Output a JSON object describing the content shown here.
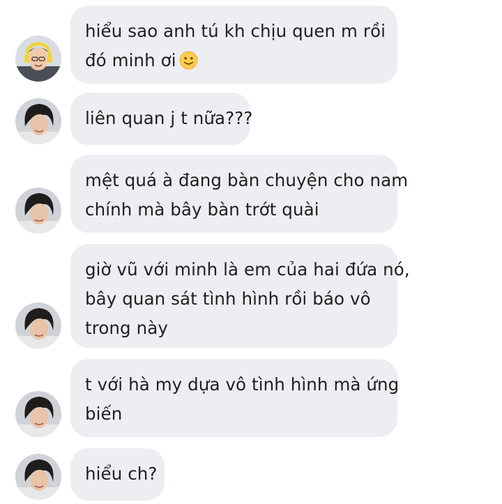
{
  "chat": {
    "messages": [
      {
        "lines": [
          "hiểu sao anh tú kh chịu quen m rồi",
          "đó minh ơi"
        ],
        "emoji": "slightly-smiling-face-icon",
        "avatar": "avatar-boy-yellow-headphones"
      },
      {
        "lines": [
          "liên quan j t nữa???"
        ],
        "avatar": "avatar-dark-hair-man"
      },
      {
        "lines": [
          "mệt quá à đang bàn chuyện cho nam",
          "chính mà bây bàn trớt quài"
        ],
        "avatar": "avatar-dark-hair-man"
      },
      {
        "lines": [
          "giờ vũ với minh là em của hai đứa nó,",
          "bây quan sát tình hình rồi báo vô",
          "trong này"
        ],
        "avatar": "avatar-dark-hair-man"
      },
      {
        "lines": [
          "t với hà my dựa vô tình hình mà ứng",
          "biến"
        ],
        "avatar": "avatar-dark-hair-man"
      },
      {
        "lines": [
          "hiểu ch?"
        ],
        "avatar": "avatar-dark-hair-man"
      }
    ]
  },
  "colors": {
    "bubble": "#eceef1",
    "text": "#1f1f1f",
    "background": "#ffffff"
  }
}
